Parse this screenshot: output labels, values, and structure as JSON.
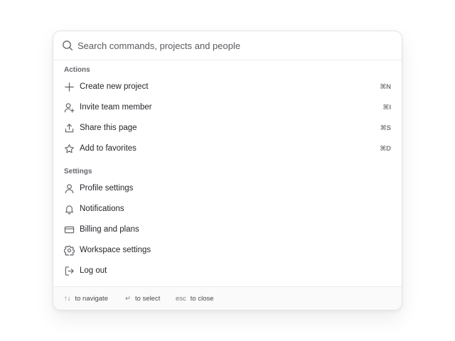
{
  "search": {
    "placeholder": "Search commands, projects and people",
    "icon": "search-icon"
  },
  "sections": [
    {
      "title": "Actions",
      "items": [
        {
          "label": "Create new project",
          "icon": "plus-icon",
          "shortcut": "⌘N"
        },
        {
          "label": "Invite team member",
          "icon": "user-plus-icon",
          "shortcut": "⌘I"
        },
        {
          "label": "Share this page",
          "icon": "share-icon",
          "shortcut": "⌘S"
        },
        {
          "label": "Add to favorites",
          "icon": "star-icon",
          "shortcut": "⌘D"
        }
      ]
    },
    {
      "title": "Settings",
      "items": [
        {
          "label": "Profile settings",
          "icon": "user-icon"
        },
        {
          "label": "Notifications",
          "icon": "bell-icon"
        },
        {
          "label": "Billing and plans",
          "icon": "credit-card-icon"
        },
        {
          "label": "Workspace settings",
          "icon": "gear-icon"
        },
        {
          "label": "Log out",
          "icon": "logout-icon"
        }
      ]
    }
  ],
  "footer": {
    "navigate": {
      "key": "↑↓",
      "text": "to navigate"
    },
    "select": {
      "key": "↵",
      "text": "to select"
    },
    "close": {
      "key": "esc",
      "text": "to close"
    }
  },
  "colors": {
    "border": "#e3e3e6",
    "text": "#26262b",
    "muted": "#66666c",
    "icon": "#5f5f66",
    "footer_bg": "#fafafa"
  }
}
